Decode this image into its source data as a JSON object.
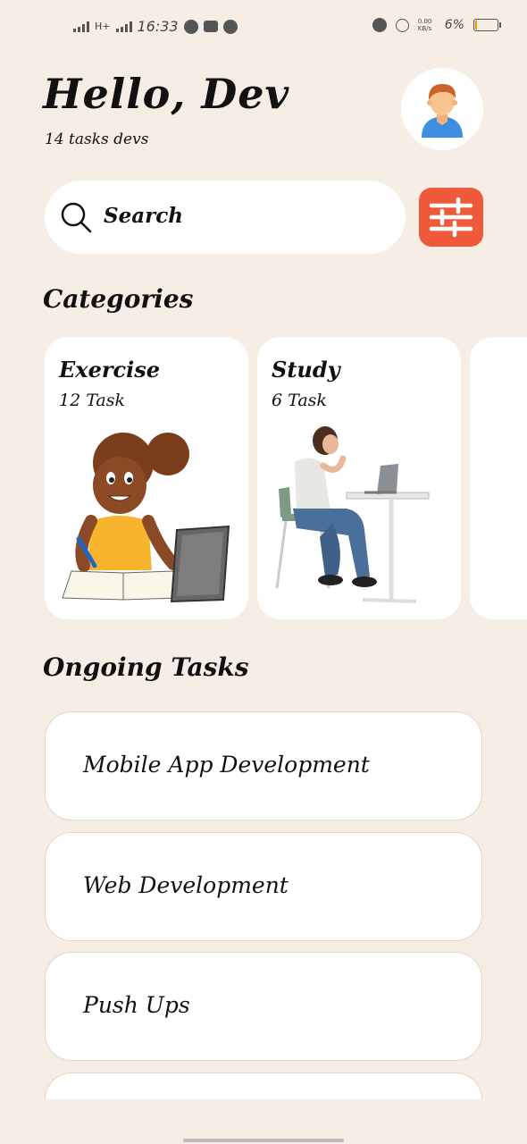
{
  "status_bar": {
    "network": "H+",
    "time": "16:33",
    "speed": "0.00 KB/s",
    "battery": "6%"
  },
  "header": {
    "greeting": "Hello, Dev",
    "subtitle": "14 tasks devs",
    "avatar_icon": "user-avatar-icon"
  },
  "search": {
    "placeholder": "Search",
    "icon": "search-icon",
    "filter_icon": "sliders-icon",
    "filter_color": "#ee5a3a"
  },
  "categories": {
    "title": "Categories",
    "items": [
      {
        "name": "Exercise",
        "count": "12 Task"
      },
      {
        "name": "Study",
        "count": "6 Task"
      }
    ]
  },
  "ongoing": {
    "title": "Ongoing Tasks",
    "items": [
      {
        "label": "Mobile App Development"
      },
      {
        "label": "Web Development"
      },
      {
        "label": "Push Ups"
      }
    ]
  },
  "colors": {
    "background": "#f6ede5",
    "card": "#ffffff",
    "accent": "#ee5a3a"
  }
}
